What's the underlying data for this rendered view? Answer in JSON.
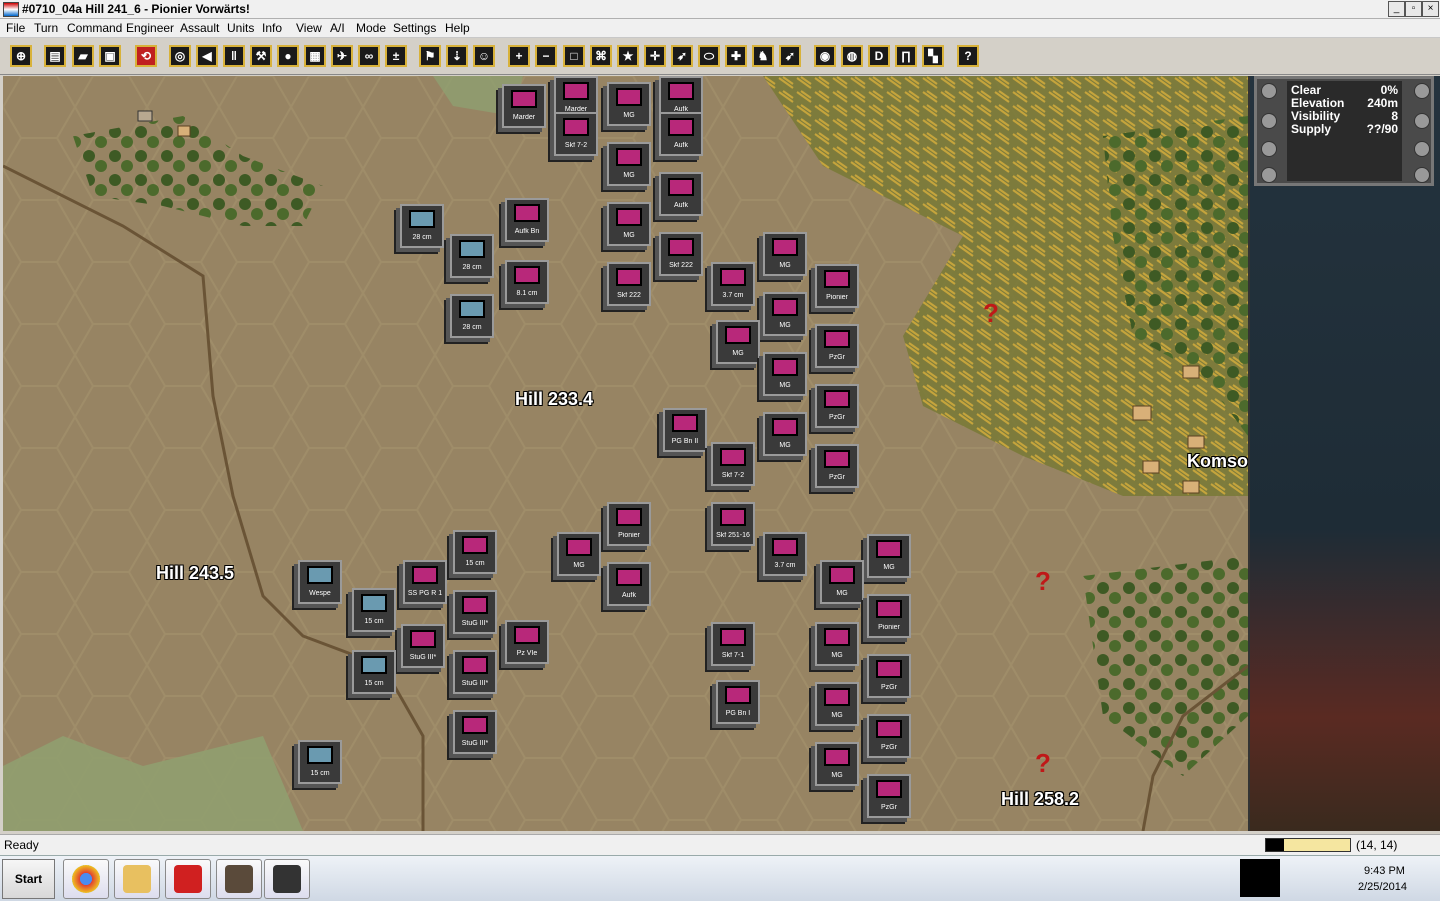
{
  "window": {
    "title": "#0710_04a Hill 241_6 - Pionier Vorwärts!"
  },
  "menu": [
    "File",
    "Turn",
    "Command",
    "Engineer",
    "Assault",
    "Units",
    "Info",
    "View",
    "A/I",
    "Mode",
    "Settings",
    "Help"
  ],
  "toolbar": {
    "icons": [
      "jump-map-icon",
      "save-turn-icon",
      "load-icon",
      "floppy-icon",
      "replay-icon",
      "target-unit-icon",
      "back-icon",
      "ammo-icon",
      "shovel-icon",
      "disruption-icon",
      "bunker-icon",
      "aircraft-icon",
      "binoculars-icon",
      "reinforce-icon",
      "flag-icon",
      "arrival-icon",
      "leader-icon",
      "zoom-in-icon",
      "zoom-out-icon",
      "hex-outline-icon",
      "mine-icon",
      "star-icon",
      "target-icon",
      "artillery-icon",
      "oval-icon",
      "medic-icon",
      "unit-info-icon",
      "move-icon",
      "red-button-icon",
      "radar-icon",
      "d-icon",
      "pillar-icon",
      "mixed-icon",
      "help-icon"
    ],
    "zoom_in": "+",
    "zoom_out": "−",
    "d_button": "D",
    "help_button": "?"
  },
  "map": {
    "hill_labels": [
      {
        "key": "hill_233",
        "text": "Hill 233.4"
      },
      {
        "key": "hill_243",
        "text": "Hill 243.5"
      },
      {
        "key": "hill_258",
        "text": "Hill 258.2"
      },
      {
        "key": "town",
        "text": "Komso"
      }
    ],
    "question_marks": [
      "?",
      "?",
      "?"
    ],
    "units": [
      {
        "label": "Marder",
        "side": "mag"
      },
      {
        "label": "Marder",
        "side": "mag"
      },
      {
        "label": "MG",
        "side": "mag"
      },
      {
        "label": "Aufk",
        "side": "mag"
      },
      {
        "label": "Skf 7-2",
        "side": "mag"
      },
      {
        "label": "Aufk",
        "side": "mag"
      },
      {
        "label": "MG",
        "side": "mag"
      },
      {
        "label": "Aufk",
        "side": "mag"
      },
      {
        "label": "28 cm",
        "side": "ger"
      },
      {
        "label": "Aufk Bn",
        "side": "mag"
      },
      {
        "label": "28 cm",
        "side": "ger"
      },
      {
        "label": "MG",
        "side": "mag"
      },
      {
        "label": "Skf 222",
        "side": "mag"
      },
      {
        "label": "MG",
        "side": "mag"
      },
      {
        "label": "8.1 cm",
        "side": "mag"
      },
      {
        "label": "Skf 222",
        "side": "mag"
      },
      {
        "label": "3.7 cm",
        "side": "mag"
      },
      {
        "label": "Pionier",
        "side": "mag"
      },
      {
        "label": "28 cm",
        "side": "ger"
      },
      {
        "label": "MG",
        "side": "mag"
      },
      {
        "label": "MG",
        "side": "mag"
      },
      {
        "label": "PzGr",
        "side": "mag"
      },
      {
        "label": "MG",
        "side": "mag"
      },
      {
        "label": "PzGr",
        "side": "mag"
      },
      {
        "label": "PG Bn II",
        "side": "mag"
      },
      {
        "label": "MG",
        "side": "mag"
      },
      {
        "label": "Skf 7-2",
        "side": "mag"
      },
      {
        "label": "PzGr",
        "side": "mag"
      },
      {
        "label": "Pionier",
        "side": "mag"
      },
      {
        "label": "Skf 251-16",
        "side": "mag"
      },
      {
        "label": "15 cm",
        "side": "mag"
      },
      {
        "label": "MG",
        "side": "mag"
      },
      {
        "label": "3.7 cm",
        "side": "mag"
      },
      {
        "label": "MG",
        "side": "mag"
      },
      {
        "label": "MG",
        "side": "mag"
      },
      {
        "label": "Aufk",
        "side": "mag"
      },
      {
        "label": "Wespe",
        "side": "ger"
      },
      {
        "label": "SS PG R 1",
        "side": "mag"
      },
      {
        "label": "15 cm",
        "side": "ger"
      },
      {
        "label": "StuG III*",
        "side": "mag"
      },
      {
        "label": "Pz VIe",
        "side": "mag"
      },
      {
        "label": "StuG III*",
        "side": "mag"
      },
      {
        "label": "15 cm",
        "side": "ger"
      },
      {
        "label": "StuG III*",
        "side": "mag"
      },
      {
        "label": "Skf 7-1",
        "side": "mag"
      },
      {
        "label": "PG Bn I",
        "side": "mag"
      },
      {
        "label": "Pionier",
        "side": "mag"
      },
      {
        "label": "MG",
        "side": "mag"
      },
      {
        "label": "PzGr",
        "side": "mag"
      },
      {
        "label": "MG",
        "side": "mag"
      },
      {
        "label": "PzGr",
        "side": "mag"
      },
      {
        "label": "StuG III*",
        "side": "mag"
      },
      {
        "label": "15 cm",
        "side": "ger"
      },
      {
        "label": "MG",
        "side": "mag"
      },
      {
        "label": "PzGr",
        "side": "mag"
      }
    ]
  },
  "info_panel": {
    "rows": [
      {
        "label": "Clear",
        "value": "0%"
      },
      {
        "label": "Elevation",
        "value": "240m"
      },
      {
        "label": "Visibility",
        "value": "8"
      },
      {
        "label": "Supply",
        "value": "??/90"
      }
    ]
  },
  "status": {
    "text": "Ready",
    "coords": "(14, 14)"
  },
  "taskbar": {
    "start": "Start",
    "time": "9:43 PM",
    "date": "2/25/2014",
    "apps": [
      "chrome-icon",
      "file-explorer-icon",
      "pdf-icon",
      "game-icon",
      "eye-icon"
    ]
  },
  "colors": {
    "unit_mag": "#b8287a",
    "unit_ger": "#6a9ab0",
    "terrain": "#978463",
    "forest": "#3e5a24"
  }
}
